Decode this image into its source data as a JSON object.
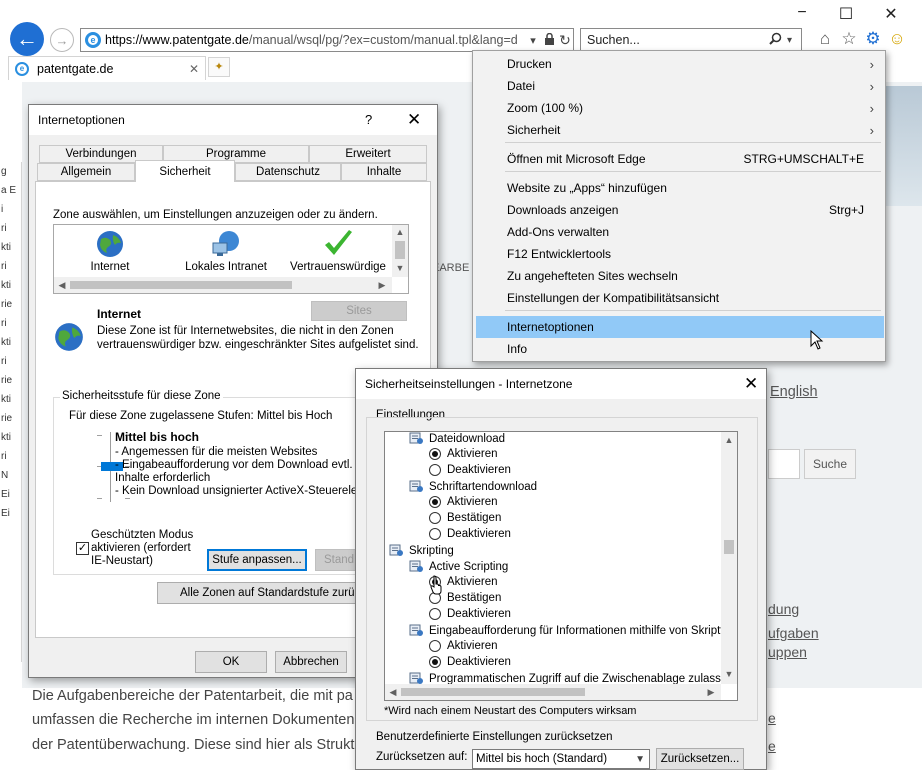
{
  "window_controls": {
    "minimize": "−",
    "maximize": "☐",
    "close": "✕"
  },
  "address": {
    "url_domain": "https://www.patentgate.de",
    "url_path": "/manual/wsql/pg/?ex=custom/manual.tpl&lang=d"
  },
  "search": {
    "placeholder": "Suchen..."
  },
  "tab": {
    "title": "patentgate.de"
  },
  "context_menu": {
    "items": [
      {
        "label": "Drucken",
        "shortcut": "",
        "submenu": true
      },
      {
        "label": "Datei",
        "shortcut": "",
        "submenu": true
      },
      {
        "label": "Zoom (100 %)",
        "shortcut": "",
        "submenu": true
      },
      {
        "label": "Sicherheit",
        "shortcut": "",
        "submenu": true
      },
      {
        "label": "Öffnen mit Microsoft Edge",
        "shortcut": "STRG+UMSCHALT+E",
        "submenu": false
      },
      {
        "label": "Website zu „Apps“ hinzufügen",
        "shortcut": "",
        "submenu": false
      },
      {
        "label": "Downloads anzeigen",
        "shortcut": "Strg+J",
        "submenu": false
      },
      {
        "label": "Add-Ons verwalten",
        "shortcut": "",
        "submenu": false
      },
      {
        "label": "F12 Entwicklertools",
        "shortcut": "",
        "submenu": false
      },
      {
        "label": "Zu angehefteten Sites wechseln",
        "shortcut": "",
        "submenu": false
      },
      {
        "label": "Einstellungen der Kompatibilitätsansicht",
        "shortcut": "",
        "submenu": false
      },
      {
        "label": "Internetoptionen",
        "shortcut": "",
        "submenu": false,
        "highlighted": true
      },
      {
        "label": "Info",
        "shortcut": "",
        "submenu": false
      }
    ],
    "submenu_arrow": "›"
  },
  "background_page": {
    "left_strip": [
      "g",
      "a E",
      "i",
      "ri",
      "kti",
      "ri",
      "kti",
      "rie",
      "ri",
      "kti",
      "ri",
      "rie",
      "kti",
      "rie",
      "kti",
      "ri",
      "N",
      "Ei",
      "Ei"
    ],
    "bearbeiten_fragment": "EARBE",
    "english_link": "English",
    "search_button": "Suche",
    "right_links": [
      "dung",
      "ufgaben",
      "uppen",
      "e",
      "e"
    ],
    "paragraph": [
      "Die Aufgabenbereiche der Patentarbeit, die mit pa",
      "umfassen die Recherche im internen Dokumenten",
      "der Patentüberwachung. Diese sind hier als Strukt"
    ]
  },
  "internet_options": {
    "title": "Internetoptionen",
    "help": "?",
    "close": "✕",
    "tabs_row1": [
      "Verbindungen",
      "Programme",
      "Erweitert"
    ],
    "tabs_row2": [
      "Allgemein",
      "Sicherheit",
      "Datenschutz",
      "Inhalte"
    ],
    "zone_instruction": "Zone auswählen, um Einstellungen anzuzeigen oder zu ändern.",
    "zones": [
      "Internet",
      "Lokales Intranet",
      "Vertrauenswürdige"
    ],
    "sites_button": "Sites",
    "zone_name": "Internet",
    "zone_description": [
      "Diese Zone ist für Internetwebsites, die nicht in den Zonen",
      "vertrauenswürdiger bzw. eingeschränkter Sites aufgelistet sind."
    ],
    "security_group_label": "Sicherheitsstufe für diese Zone",
    "allowed_levels": "Für diese Zone zugelassene Stufen: Mittel bis Hoch",
    "level_title": "Mittel bis hoch",
    "level_points": [
      "- Angemessen für die meisten Websites",
      "- Eingabeaufforderung vor dem Download evtl. ur",
      "Inhalte erforderlich",
      "- Kein Download unsignierter ActiveX-Steuereleme"
    ],
    "protected_mode": [
      "Geschützten Modus",
      "aktivieren (erfordert",
      "IE-Neustart)"
    ],
    "protected_mode_checked": true,
    "check_mark": "✓",
    "custom_level_button": "Stufe anpassen...",
    "default_level_button": "Stand",
    "reset_all_button": "Alle Zonen auf Standardstufe zurück",
    "ok_button": "OK",
    "cancel_button": "Abbrechen"
  },
  "security_settings": {
    "title": "Sicherheitseinstellungen - Internetzone",
    "close": "✕",
    "settings_label": "Einstellungen",
    "tree": [
      {
        "type": "category",
        "text": "Dateidownload",
        "level": 1
      },
      {
        "type": "radio",
        "text": "Aktivieren",
        "checked": true
      },
      {
        "type": "radio",
        "text": "Deaktivieren",
        "checked": false
      },
      {
        "type": "category",
        "text": "Schriftartendownload",
        "level": 1
      },
      {
        "type": "radio",
        "text": "Aktivieren",
        "checked": true
      },
      {
        "type": "radio",
        "text": "Bestätigen",
        "checked": false
      },
      {
        "type": "radio",
        "text": "Deaktivieren",
        "checked": false
      },
      {
        "type": "category",
        "text": "Skripting",
        "level": 0
      },
      {
        "type": "category",
        "text": "Active Scripting",
        "level": 1
      },
      {
        "type": "radio",
        "text": "Aktivieren",
        "checked": true
      },
      {
        "type": "radio",
        "text": "Bestätigen",
        "checked": false
      },
      {
        "type": "radio",
        "text": "Deaktivieren",
        "checked": false
      },
      {
        "type": "category",
        "text": "Eingabeaufforderung für Informationen mithilfe von Skriptfer",
        "level": 1
      },
      {
        "type": "radio",
        "text": "Aktivieren",
        "checked": false
      },
      {
        "type": "radio",
        "text": "Deaktivieren",
        "checked": true
      },
      {
        "type": "category",
        "text": "Programmatischen Zugriff auf die Zwischenablage zulassen",
        "level": 1
      }
    ],
    "restart_note": "*Wird nach einem Neustart des Computers wirksam",
    "reset_group_label": "Benutzerdefinierte Einstellungen zurücksetzen",
    "reset_to_label": "Zurücksetzen auf:",
    "reset_to_value": "Mittel bis hoch (Standard)",
    "reset_button": "Zurücksetzen..."
  }
}
